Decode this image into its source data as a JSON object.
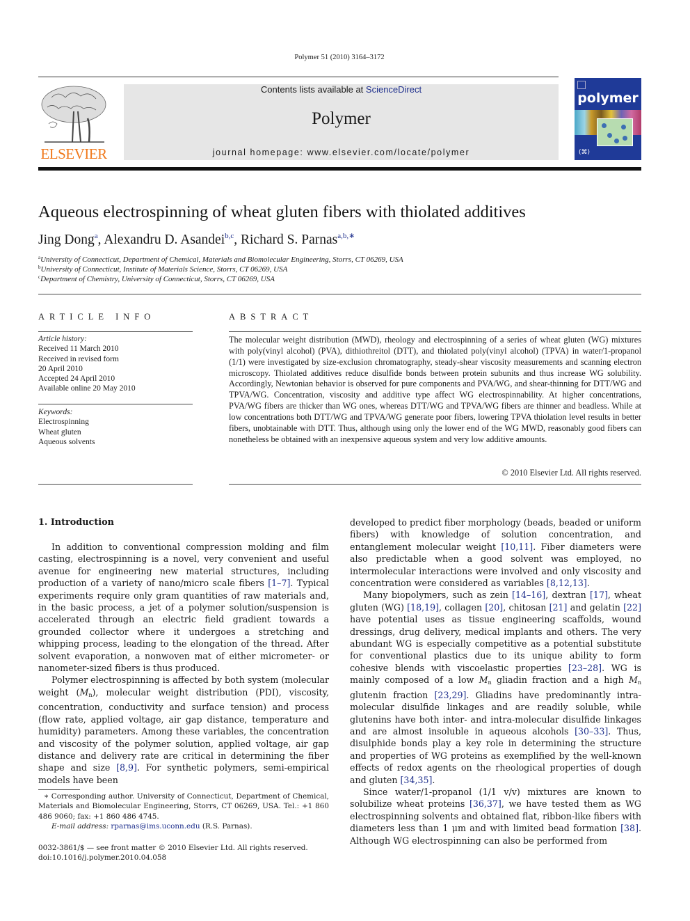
{
  "header": {
    "citation": "Polymer 51 (2010) 3164–3172",
    "contents_prefix": "Contents lists available at ",
    "contents_link": "ScienceDirect",
    "journal_name": "Polymer",
    "homepage_prefix": "journal homepage: ",
    "homepage_url": "www.elsevier.com/locate/polymer",
    "publisher_logo_text": "ELSEVIER",
    "cover_title": "polymer",
    "cover_footer": "(⌘)"
  },
  "article": {
    "title": "Aqueous electrospinning of wheat gluten fibers with thiolated additives",
    "authors": [
      {
        "name": "Jing Dong",
        "affil": "a"
      },
      {
        "name": "Alexandru D. Asandei",
        "affil": "b,c"
      },
      {
        "name": "Richard S. Parnas",
        "affil": "a,b,∗"
      }
    ],
    "affiliations": [
      {
        "mark": "a",
        "text": "University of Connecticut, Department of Chemical, Materials and Biomolecular Engineering, Storrs, CT 06269, USA"
      },
      {
        "mark": "b",
        "text": "University of Connecticut, Institute of Materials Science, Storrs, CT 06269, USA"
      },
      {
        "mark": "c",
        "text": "Department of Chemistry, University of Connecticut, Storrs, CT 06269, USA"
      }
    ]
  },
  "article_info": {
    "heading": "ARTICLE INFO",
    "history_label": "Article history:",
    "history": [
      "Received 11 March 2010",
      "Received in revised form",
      "20 April 2010",
      "Accepted 24 April 2010",
      "Available online 20 May 2010"
    ],
    "keywords_label": "Keywords:",
    "keywords": [
      "Electrospinning",
      "Wheat gluten",
      "Aqueous solvents"
    ]
  },
  "abstract": {
    "heading": "ABSTRACT",
    "text": "The molecular weight distribution (MWD), rheology and electrospinning of a series of wheat gluten (WG) mixtures with poly(vinyl alcohol) (PVA), dithiothreitol (DTT), and thiolated poly(vinyl alcohol) (TPVA) in water/1-propanol (1/1) were investigated by size-exclusion chromatography, steady-shear viscosity measurements and scanning electron microscopy. Thiolated additives reduce disulfide bonds between protein subunits and thus increase WG solubility. Accordingly, Newtonian behavior is observed for pure components and PVA/WG, and shear-thinning for DTT/WG and TPVA/WG. Concentration, viscosity and additive type affect WG electrospinnability. At higher concentrations, PVA/WG fibers are thicker than WG ones, whereas DTT/WG and TPVA/WG fibers are thinner and beadless. While at low concentrations both DTT/WG and TPVA/WG generate poor fibers, lowering TPVA thiolation level results in better fibers, unobtainable with DTT. Thus, although using only the lower end of the WG MWD, reasonably good fibers can nonetheless be obtained with an inexpensive aqueous system and very low additive amounts.",
    "copyright": "© 2010 Elsevier Ltd. All rights reserved."
  },
  "body": {
    "section_heading": "1.  Introduction",
    "left": {
      "p1": [
        {
          "t": "In addition to conventional compression molding and film casting, electrospinning is a novel, very convenient and useful avenue for engineering new material structures, including production of a variety of nano/micro scale fibers "
        },
        {
          "r": "[1–7]"
        },
        {
          "t": ". Typical experiments require only gram quantities of raw materials and, in the basic process, a jet of a polymer solution/suspension is accelerated through an electric field gradient towards a grounded collector where it undergoes a stretching and whipping process, leading to the elongation of the thread. After solvent evaporation, a nonwoven mat of either micrometer- or nanometer-sized fibers is thus produced."
        }
      ],
      "p2": [
        {
          "t": "Polymer electrospinning is affected by both system (molecular weight ("
        },
        {
          "m": "M",
          "s": "n"
        },
        {
          "t": "), molecular weight distribution (PDI), viscosity, concentration, conductivity and surface tension) and process (flow rate, applied voltage, air gap distance, temperature and humidity) parameters. Among these variables, the concentration and viscosity of the polymer solution, applied voltage, air gap distance and delivery rate are critical in determining the fiber shape and size "
        },
        {
          "r": "[8,9]"
        },
        {
          "t": ". For synthetic polymers, semi-empirical models have been"
        }
      ]
    },
    "right": {
      "p1": [
        {
          "t": "developed to predict fiber morphology (beads, beaded or uniform fibers) with knowledge of solution concentration, and entanglement molecular weight "
        },
        {
          "r": "[10,11]"
        },
        {
          "t": ". Fiber diameters were also predictable when a good solvent was employed, no intermolecular interactions were involved and only viscosity and concentration were considered as variables "
        },
        {
          "r": "[8,12,13]"
        },
        {
          "t": "."
        }
      ],
      "p2": [
        {
          "t": "Many biopolymers, such as zein "
        },
        {
          "r": "[14–16]"
        },
        {
          "t": ", dextran "
        },
        {
          "r": "[17]"
        },
        {
          "t": ", wheat gluten (WG) "
        },
        {
          "r": "[18,19]"
        },
        {
          "t": ", collagen "
        },
        {
          "r": "[20]"
        },
        {
          "t": ", chitosan "
        },
        {
          "r": "[21]"
        },
        {
          "t": " and gelatin "
        },
        {
          "r": "[22]"
        },
        {
          "t": " have potential uses as tissue engineering scaffolds, wound dressings, drug delivery, medical implants and others. The very abundant WG is especially competitive as a potential substitute for conventional plastics due to its unique ability to form cohesive blends with viscoelastic properties "
        },
        {
          "r": "[23–28]"
        },
        {
          "t": ". WG is mainly composed of a low "
        },
        {
          "m": "M",
          "s": "n"
        },
        {
          "t": " gliadin fraction and a high "
        },
        {
          "m": "M",
          "s": "n"
        },
        {
          "t": " glutenin fraction "
        },
        {
          "r": "[23,29]"
        },
        {
          "t": ". Gliadins have predominantly intra-molecular disulfide linkages and are readily soluble, while glutenins have both inter- and intra-molecular disulfide linkages and are almost insoluble in aqueous alcohols "
        },
        {
          "r": "[30–33]"
        },
        {
          "t": ". Thus, disulphide bonds play a key role in determining the structure and properties of WG proteins as exemplified by the well-known effects of redox agents on the rheological properties of dough and gluten "
        },
        {
          "r": "[34,35]"
        },
        {
          "t": "."
        }
      ],
      "p3": [
        {
          "t": "Since water/1-propanol (1/1 v/v) mixtures are known to solubilize wheat proteins "
        },
        {
          "r": "[36,37]"
        },
        {
          "t": ", we have tested them as WG electrospinning solvents and obtained flat, ribbon-like fibers with diameters less than 1 μm and with limited bead formation "
        },
        {
          "r": "[38]"
        },
        {
          "t": ". Although WG electrospinning can also be performed from"
        }
      ]
    }
  },
  "footnote": {
    "corresponding": "∗ Corresponding author. University of Connecticut, Department of Chemical, Materials and Biomolecular Engineering, Storrs, CT 06269, USA. Tel.: +1 860 486 9060; fax: +1 860 486 4745.",
    "email_label": "E-mail address: ",
    "email": "rparnas@ims.uconn.edu",
    "email_suffix": " (R.S. Parnas).",
    "issn": "0032-3861/$ — see front matter © 2010 Elsevier Ltd. All rights reserved.",
    "doi": "doi:10.1016/j.polymer.2010.04.058"
  },
  "colors": {
    "link": "#1e2f8c",
    "elsevier_orange": "#f07a1e",
    "banner_gray": "#e6e6e6",
    "cover_blue": "#1f3a98"
  }
}
